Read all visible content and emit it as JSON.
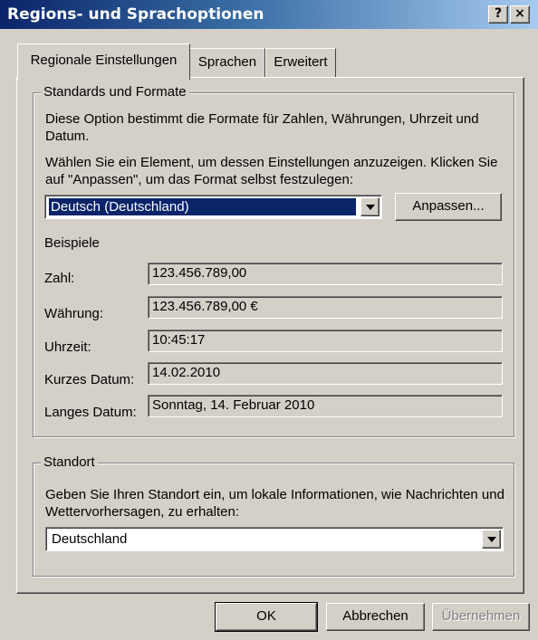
{
  "window": {
    "title": "Regions- und Sprachoptionen"
  },
  "titlebar_buttons": {
    "help": "?",
    "close": "×"
  },
  "tabs": [
    {
      "label": "Regionale Einstellungen",
      "active": true
    },
    {
      "label": "Sprachen",
      "active": false
    },
    {
      "label": "Erweitert",
      "active": false
    }
  ],
  "standards": {
    "legend": "Standards und Formate",
    "description": "Diese Option bestimmt die Formate für Zahlen, Währungen, Uhrzeit und Datum.",
    "instruction": "Wählen Sie ein Element, um dessen Einstellungen anzuzeigen. Klicken Sie auf \"Anpassen\", um das Format selbst festzulegen:",
    "locale_value": "Deutsch (Deutschland)",
    "customize_label": "Anpassen...",
    "examples_heading": "Beispiele",
    "examples": [
      {
        "label": "Zahl:",
        "value": "123.456.789,00"
      },
      {
        "label": "Währung:",
        "value": "123.456.789,00 €"
      },
      {
        "label": "Uhrzeit:",
        "value": "10:45:17"
      },
      {
        "label": "Kurzes Datum:",
        "value": "14.02.2010"
      },
      {
        "label": "Langes Datum:",
        "value": "Sonntag, 14. Februar 2010"
      }
    ]
  },
  "location": {
    "legend": "Standort",
    "description": "Geben Sie Ihren Standort ein, um lokale Informationen, wie Nachrichten und Wettervorhersagen, zu erhalten:",
    "value": "Deutschland"
  },
  "buttons": {
    "ok": "OK",
    "cancel": "Abbrechen",
    "apply": "Übernehmen"
  },
  "colors": {
    "titlebar_start": "#0a246a",
    "titlebar_end": "#a6caf0",
    "face": "#d4d0c8",
    "selection": "#0a246a"
  }
}
